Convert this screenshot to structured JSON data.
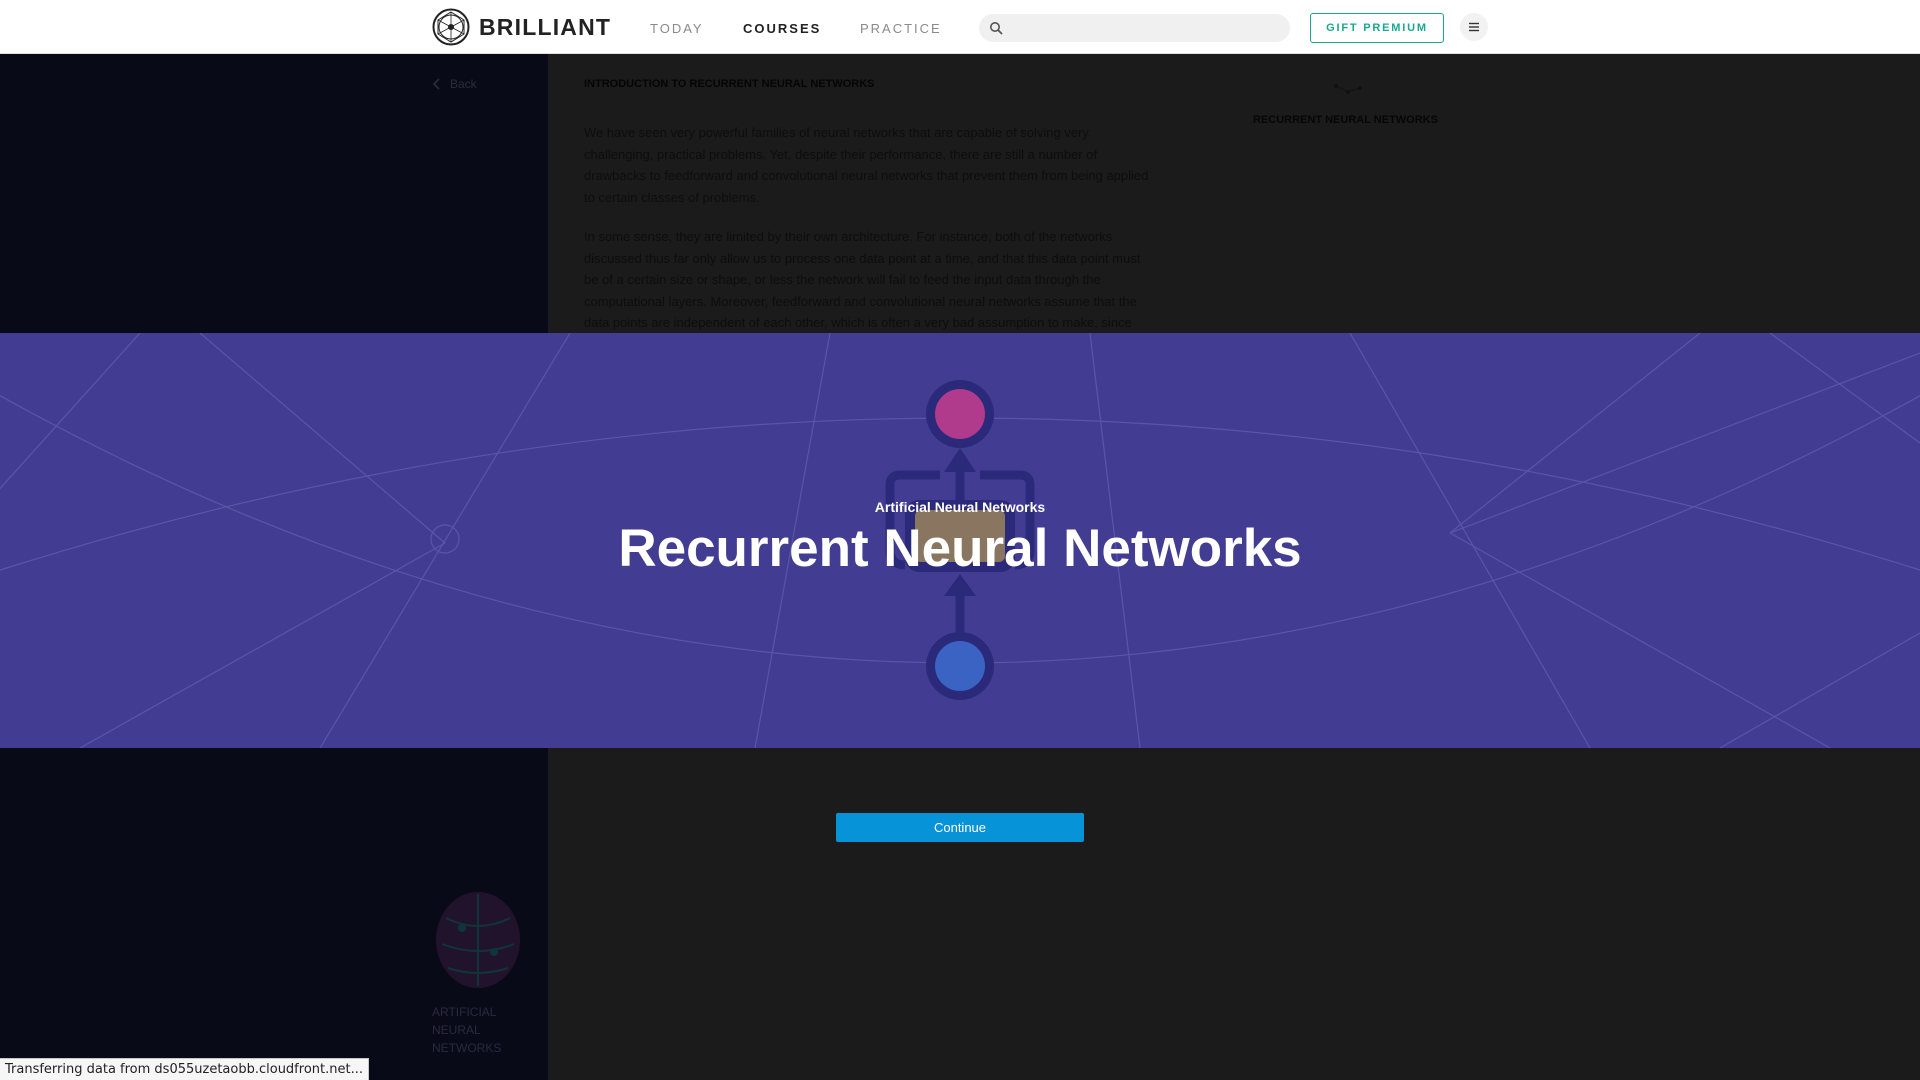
{
  "header": {
    "logo_text": "BRILLIANT",
    "nav": [
      {
        "label": "TODAY",
        "active": false
      },
      {
        "label": "COURSES",
        "active": true
      },
      {
        "label": "PRACTICE",
        "active": false
      }
    ],
    "search": {
      "value": "",
      "placeholder": ""
    },
    "gift_button_label": "GIFT PREMIUM"
  },
  "page": {
    "back_label": "Back",
    "article_title": "INTRODUCTION TO RECURRENT NEURAL NETWORKS",
    "paragraphs": [
      "We have seen very powerful families of neural networks that are capable of solving very challenging, practical problems. Yet, despite their performance, there are still a number of drawbacks to feedforward and convolutional neural networks that prevent them from being applied to certain classes of problems.",
      "In some sense, they are limited by their own architecture. For instance, both of the networks discussed thus far only allow us to process one data point at a time, and that this data point must be of a certain size or shape, or less the network will fail to feed the input data through the computational layers. Moreover, feedforward and convolutional neural networks assume that the data points are independent of each other, which is often a very bad assumption to make, since"
    ],
    "right_panel_title": "RECURRENT NEURAL NETWORKS",
    "sidebar_course_label": "ARTIFICIAL NEURAL NETWORKS"
  },
  "banner": {
    "subtitle": "Artificial Neural Networks",
    "title": "Recurrent Neural Networks",
    "colors": {
      "background": "#423d93",
      "output_node": "#b03a8c",
      "input_node": "#3a63c4",
      "hidden_box": "#8a7560"
    }
  },
  "continue_label": "Continue",
  "status_text": "Transferring data from ds055uzetaobb.cloudfront.net...",
  "colors": {
    "accent": "#19a88f",
    "primary_button": "#0693d8"
  }
}
